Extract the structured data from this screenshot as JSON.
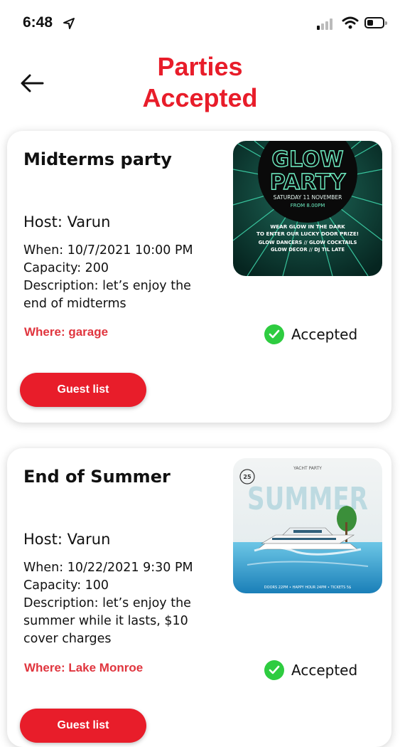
{
  "status_bar": {
    "time": "6:48"
  },
  "header": {
    "title_line1": "Parties",
    "title_line2": "Accepted"
  },
  "parties": [
    {
      "name": "Midterms party",
      "host": "Host: Varun",
      "when": "When: 10/7/2021 10:00 PM",
      "capacity": "Capacity: 200",
      "description": "Description: let’s enjoy the end of midterms",
      "where": "Where: garage",
      "status": "Accepted",
      "button": "Guest list",
      "flyer": {
        "headline1": "GLOW",
        "headline2": "PARTY",
        "date": "SATURDAY 11 NOVEMBER",
        "time": "FROM 8.00PM",
        "line1": "WEAR GLOW IN THE DARK",
        "line2": "TO ENTER OUR LUCKY DOOR PRIZE!",
        "line3": "GLOW DANCERS // GLOW COCKTAILS",
        "line4": "GLOW DECOR // DJ TIL LATE"
      }
    },
    {
      "name": "End of Summer",
      "host": "Host: Varun",
      "when": "When: 10/22/2021 9:30 PM",
      "capacity": "Capacity: 100",
      "description": "Description: let’s enjoy the summer while it lasts, $10 cover charges",
      "where": "Where: Lake Monroe",
      "status": "Accepted",
      "button": "Guest list",
      "flyer": {
        "top": "YACHT PARTY",
        "badge": "25",
        "headline": "SUMMER",
        "footer": "DOORS 22PM • HAPPY HOUR 24PM • TICKETS 5$"
      }
    }
  ],
  "colors": {
    "accent": "#e81d2a",
    "where": "#e0353e",
    "check": "#2ecc40"
  }
}
